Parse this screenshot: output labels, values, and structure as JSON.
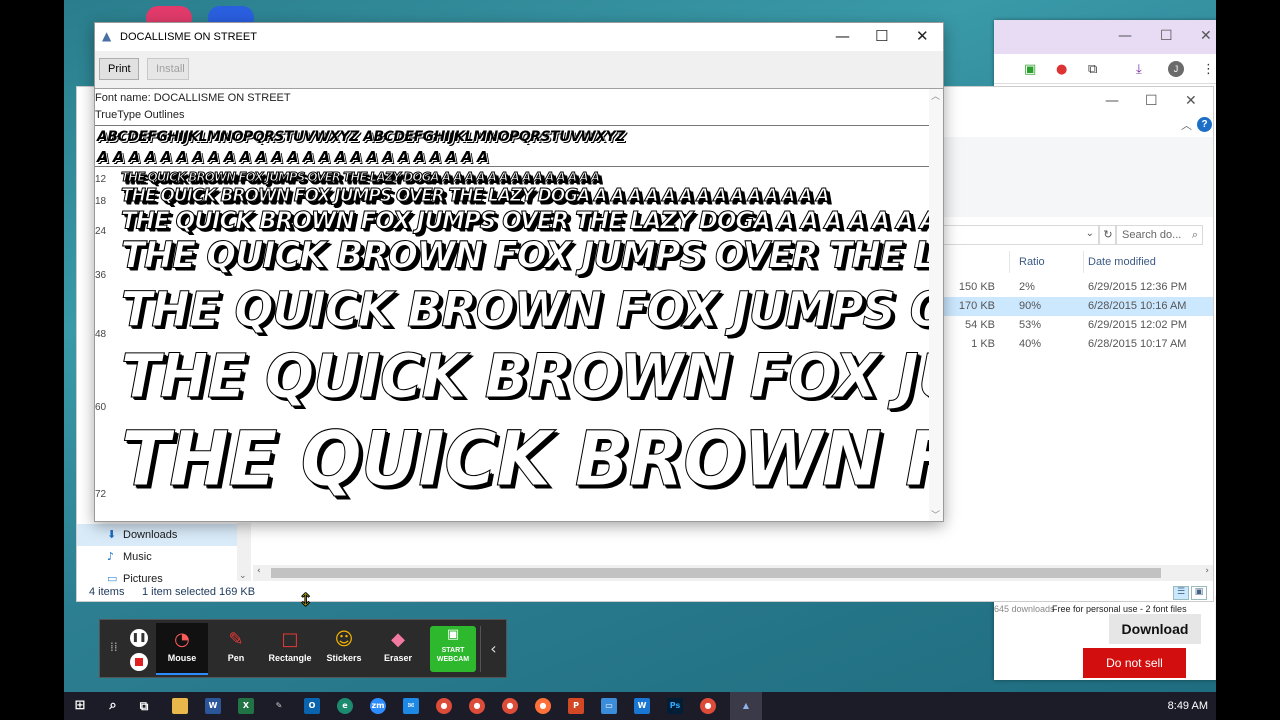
{
  "font_viewer": {
    "title": "DOCALLISME ON STREET",
    "print_label": "Print",
    "install_label": "Install",
    "font_name_line": "Font name: DOCALLISME ON STREET",
    "outline_line": "TrueType Outlines",
    "glyph_upper": "ABCDEFGHIJKLMNOPQRSTUVWXYZ ABCDEFGHIJKLMNOPQRSTUVWXYZ",
    "glyph_symbols": "A A A A A A A A A A A A A A   A   A   A A A A A A A A A",
    "sample_text": "THE QUICK BROWN FOX JUMPS OVER THE LAZY DOGA  A A A A A A A A A A A A A A",
    "sizes": [
      "12",
      "18",
      "24",
      "36",
      "48",
      "60",
      "72"
    ]
  },
  "explorer": {
    "columns": {
      "ratio": "Ratio",
      "date_modified": "Date modified"
    },
    "search_placeholder": "Search do...",
    "files": [
      {
        "size": "150 KB",
        "ratio": "2%",
        "date": "6/29/2015 12:36 PM"
      },
      {
        "size": "170 KB",
        "ratio": "90%",
        "date": "6/28/2015 10:16 AM"
      },
      {
        "size": "54 KB",
        "ratio": "53%",
        "date": "6/29/2015 12:02 PM"
      },
      {
        "size": "1 KB",
        "ratio": "40%",
        "date": "6/28/2015 10:17 AM"
      }
    ],
    "nav": [
      {
        "label": "Downloads",
        "icon": "download-arrow-icon"
      },
      {
        "label": "Music",
        "icon": "music-note-icon"
      },
      {
        "label": "Pictures",
        "icon": "pictures-icon"
      }
    ],
    "status_items": "4 items",
    "status_selected": "1 item selected",
    "status_size": "169 KB"
  },
  "browser": {
    "downloads_count": "645 downloads",
    "license": "Free for personal use - 2 font files",
    "download_label": "Download",
    "do_not_sell_label": "Do not sell",
    "avatar_letter": "J"
  },
  "annotation_toolbar": {
    "tools": [
      {
        "label": "Mouse",
        "icon": "mouse-pointer-icon"
      },
      {
        "label": "Pen",
        "icon": "pen-icon"
      },
      {
        "label": "Rectangle",
        "icon": "rectangle-icon"
      },
      {
        "label": "Stickers",
        "icon": "sticker-smiley-icon"
      },
      {
        "label": "Eraser",
        "icon": "eraser-icon"
      }
    ],
    "webcam_label": "START WEBCAM"
  },
  "taskbar": {
    "clock": "8:49 AM",
    "colors": {
      "background": "#1c1c28",
      "accent": "#2d8cff"
    }
  }
}
